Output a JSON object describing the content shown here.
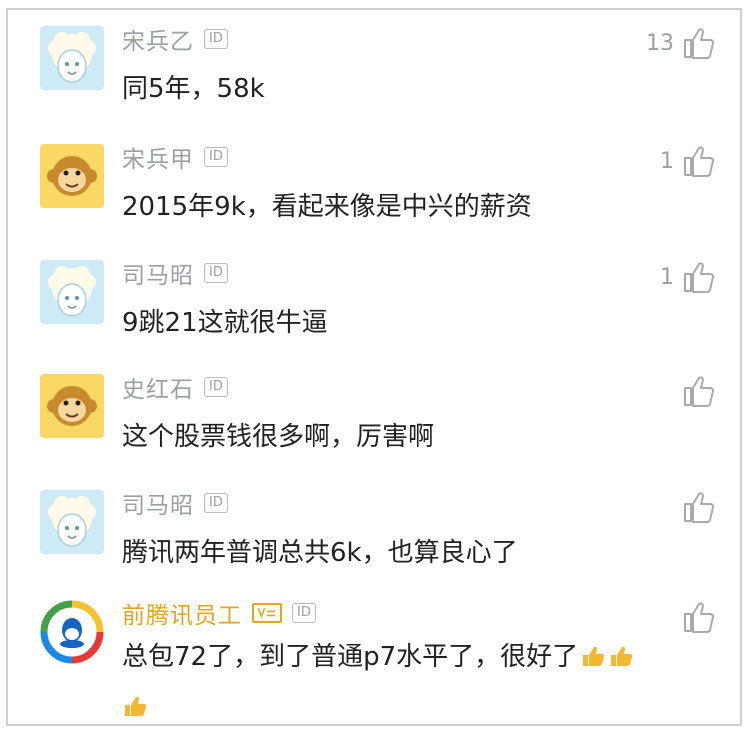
{
  "comments": [
    {
      "name": "宋兵乙",
      "id_badge": "ID",
      "text": "同5年，58k",
      "likes": "13",
      "avatar": "sheep"
    },
    {
      "name": "宋兵甲",
      "id_badge": "ID",
      "text": "2015年9k，看起来像是中兴的薪资",
      "likes": "1",
      "avatar": "monkey"
    },
    {
      "name": "司马昭",
      "id_badge": "ID",
      "text": "9跳21这就很牛逼",
      "likes": "1",
      "avatar": "sheep"
    },
    {
      "name": "史红石",
      "id_badge": "ID",
      "text": "这个股票钱很多啊，厉害啊",
      "likes": "",
      "avatar": "monkey"
    },
    {
      "name": "司马昭",
      "id_badge": "ID",
      "text": "腾讯两年普调总共6k，也算良心了",
      "likes": "",
      "avatar": "sheep"
    },
    {
      "name": "前腾讯员工",
      "id_badge": "ID",
      "text_line1": "总包72了，到了普通p7水平了，很好了",
      "likes": "",
      "avatar": "tencent-qq",
      "verified": true
    }
  ],
  "colors": {
    "name_gray": "#9aa0a6",
    "vip_gold": "#e2a51c",
    "text": "#222222"
  }
}
